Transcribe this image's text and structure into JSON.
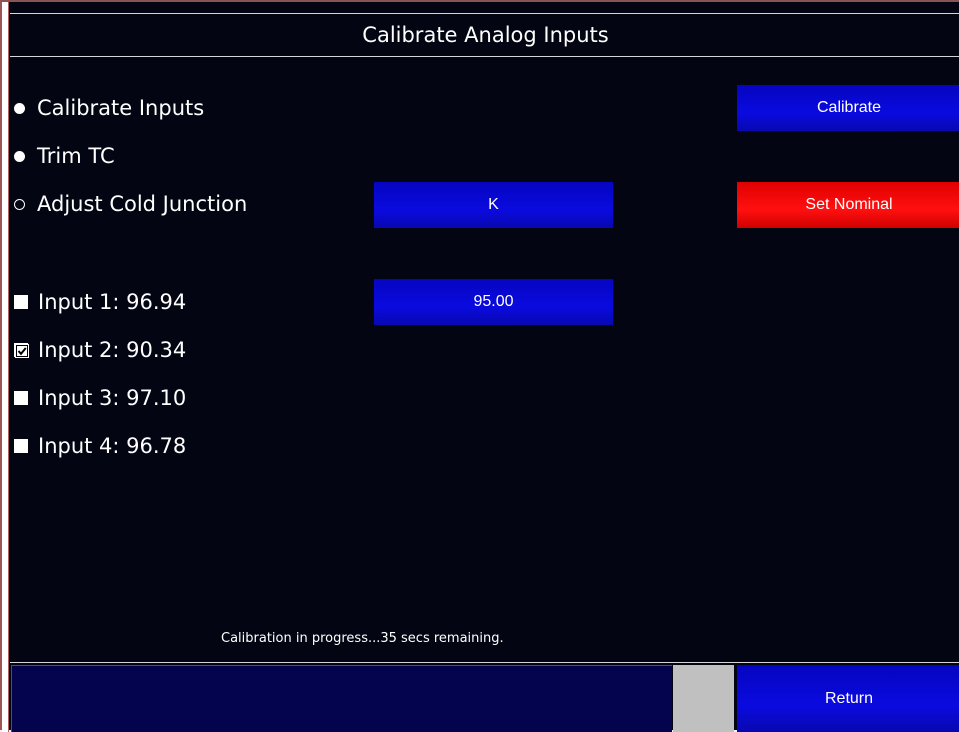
{
  "window": {
    "title": "Calibrate Analog Inputs"
  },
  "modes": [
    {
      "label": "Calibrate Inputs",
      "selected": true
    },
    {
      "label": "Trim TC",
      "selected": true
    },
    {
      "label": "Adjust Cold Junction",
      "selected": false
    }
  ],
  "inputs": [
    {
      "label": "Input 1: 96.94",
      "checked": false
    },
    {
      "label": "Input 2: 90.34",
      "checked": true
    },
    {
      "label": "Input 3: 97.10",
      "checked": false
    },
    {
      "label": "Input 4: 96.78",
      "checked": false
    }
  ],
  "buttons": {
    "calibrate": "Calibrate",
    "tc_type": "K",
    "set_nominal": "Set Nominal",
    "value": "95.00",
    "return": "Return"
  },
  "status": {
    "message": "Calibration in progress...35 secs remaining."
  },
  "colors": {
    "background": "#030612",
    "button_blue": "#0808d0",
    "button_red": "#ff0000",
    "bottom_bar": "#03034e",
    "gray_block": "#c0c0c0"
  }
}
